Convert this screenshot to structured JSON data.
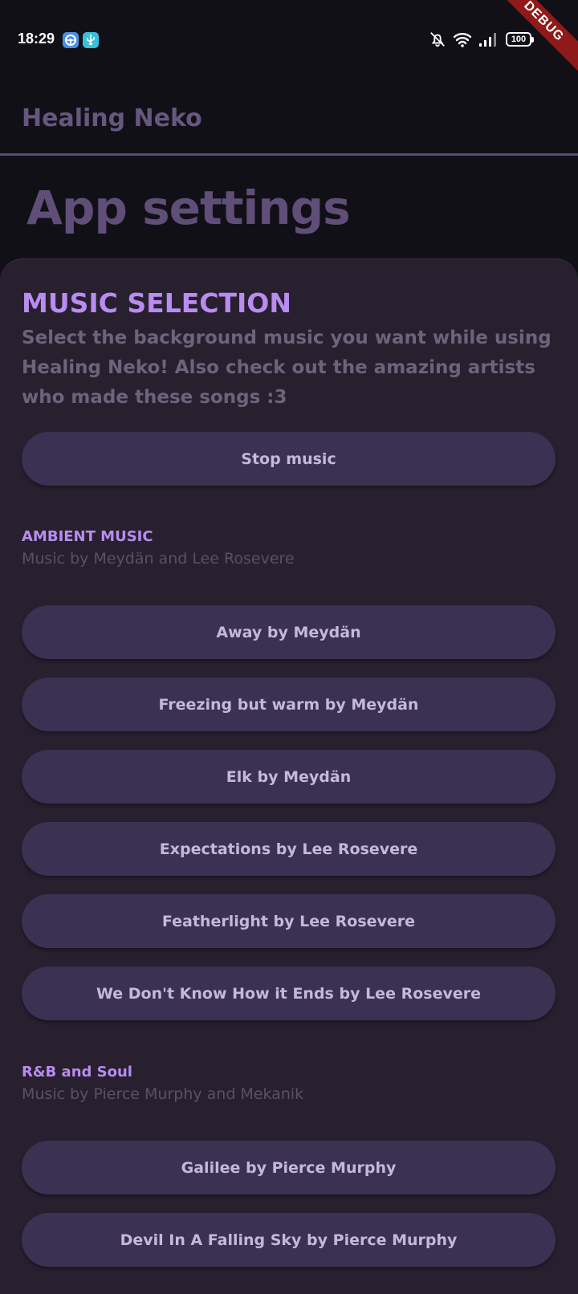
{
  "status_bar": {
    "time": "18:29",
    "battery": "100",
    "icons": [
      "app-icon-steering",
      "app-icon-usb",
      "bell-off-icon",
      "wifi-icon",
      "signal-icon",
      "battery-icon"
    ]
  },
  "debug_banner": "DEBUG",
  "app_bar": {
    "title": "Healing Neko"
  },
  "page": {
    "heading": "App settings"
  },
  "music_section": {
    "title": "MUSIC SELECTION",
    "description": "Select the background music you want while using Healing Neko! Also check out the amazing artists who made these songs :3",
    "stop_label": "Stop music"
  },
  "groups": [
    {
      "title": "AMBIENT MUSIC",
      "subtitle": "Music by Meydän and Lee Rosevere",
      "tracks": [
        "Away by Meydän",
        "Freezing but warm by Meydän",
        "Elk by Meydän",
        "Expectations by Lee Rosevere",
        "Featherlight by Lee Rosevere",
        "We Don't Know How it Ends by Lee Rosevere"
      ]
    },
    {
      "title": "R&B and Soul",
      "subtitle": "Music by Pierce Murphy and Mekanik",
      "tracks": [
        "Galilee by Pierce Murphy",
        "Devil In A Falling Sky by Pierce Murphy"
      ]
    }
  ],
  "colors": {
    "background": "#121017",
    "sheet": "#28202f",
    "accent": "#b88cf0",
    "button": "#3b3152",
    "button_text": "#c6b7dc",
    "debug": "#8e1a1a"
  }
}
